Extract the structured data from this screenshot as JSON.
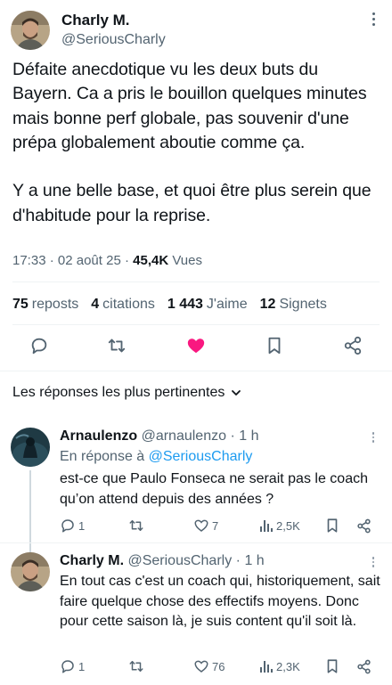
{
  "main_tweet": {
    "author_name": "Charly M.",
    "author_handle": "@SeriousCharly",
    "text": "Défaite anecdotique vu les deux buts du Bayern. Ca a pris le bouillon quelques minutes mais bonne perf globale, pas souvenir d'une prépa globalement aboutie comme ça.\n\nY a une belle base, et quoi être plus serein que d'habitude pour la reprise.",
    "time": "17:33",
    "date": "02 août 25",
    "views_count": "45,4K",
    "views_label": "Vues",
    "stats": {
      "reposts_count": "75",
      "reposts_label": "reposts",
      "quotes_count": "4",
      "quotes_label": "citations",
      "likes_count": "1 443",
      "likes_label": "J'aime",
      "bookmarks_count": "12",
      "bookmarks_label": "Signets"
    }
  },
  "replies_section": {
    "title": "Les réponses les plus pertinentes"
  },
  "replies": [
    {
      "author_name": "Arnaulenzo",
      "author_handle": "@arnaulenzo",
      "time": "1 h",
      "reply_to_prefix": "En réponse à",
      "reply_to_handle": "@SeriousCharly",
      "text": "est-ce que Paulo Fonseca ne serait pas le coach qu’on attend depuis des années ?",
      "replies_count": "1",
      "likes_count": "7",
      "views_count": "2,5K"
    },
    {
      "author_name": "Charly M.",
      "author_handle": "@SeriousCharly",
      "time": "1 h",
      "text": "En tout cas c'est un coach qui, historiquement, sait faire quelque chose des effectifs moyens. Donc pour cette saison là, je suis content qu'il soit là.",
      "replies_count": "1",
      "likes_count": "76",
      "views_count": "2,3K"
    }
  ],
  "colors": {
    "accent": "#1d9bf0",
    "like": "#f91880",
    "muted": "#536471"
  }
}
